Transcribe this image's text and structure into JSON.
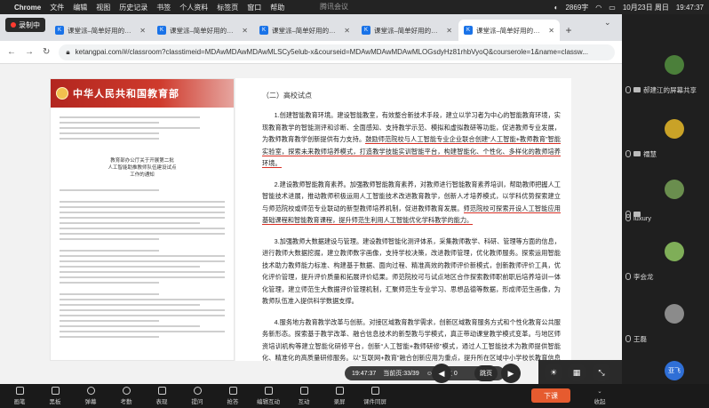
{
  "menubar": {
    "app": "Chrome",
    "items": [
      "文件",
      "编辑",
      "视图",
      "历史记录",
      "书签",
      "个人资料",
      "标签页",
      "窗口",
      "帮助"
    ],
    "center_title": "腾讯会议",
    "status": "2869字",
    "date": "10月23日 周日",
    "time": "19:47:37"
  },
  "recording": {
    "label": "录制中"
  },
  "tabs": [
    {
      "title": "课堂派–简单好用的互动课堂管理",
      "active": false
    },
    {
      "title": "课堂派–简单好用的互动课堂管理",
      "active": false
    },
    {
      "title": "课堂派–简单好用的互动课堂管理",
      "active": false
    },
    {
      "title": "课堂派–简单好用的互动课堂管理",
      "active": false
    },
    {
      "title": "课堂派–简单好用的互动课堂管理",
      "active": true
    }
  ],
  "tab_favicon": "K",
  "address": {
    "url": "ketangpai.com/#/classroom?classtimeid=MDAwMDAwMDAwMLSCy5elub-x&courseid=MDAwMDAwMDAwMLOGsdyHz81rhbVyoQ&courserole=1&name=classw..."
  },
  "doc_left": {
    "ministry": "中华人民共和国教育部",
    "title_lines": [
      "教育部办公厅关于开展第二批",
      "人工智能助推教师队伍建设试点",
      "工作的通知"
    ]
  },
  "doc_right": {
    "section_title": "（二）高校试点",
    "p1_a": "1.创建智能教育环境。建设智能教室，有效整合新技术手段，建立以学习者为中心的智能教育环境，实现教育教学的智能测评和诊断、全面感知、支持教学示范、模拟和虚拟教研等功能，促进教师专业发展，为教师教育教学创新提供有力支持。",
    "p1_b": "鼓励师范院校与人工智能专业企业联合创建“人工智能+教师教育”智能实验室，探索未来教师培养模式，打造教学技能实训智能平台，构建智能化、个性化、多样化的教师培养环境。",
    "p2_a": "2.建设教师智能教育素养。加强教师智能教育素养，对教师进行智能教育素养培训，帮助教师把握人工智能技术进展，推动教师积极运用人工智能技术改进教育教学，创新人才培养模式，以学科优势探索建立与师范院校或师范专业联动的新型教师培养机制，促进教师教育发展。",
    "p2_b": "师范院校可探索开设人工智能应用基础课程和智能教育课程，提升师范生利用人工智能优化学科教学的能力。",
    "p3": "3.加强教师大数据建设与管理。建设教师智能化测评体系，采集教师教学、科研、管理等方面的信息，进行教师大数据挖掘，建立教师数字画像，支持学校决策，改进教师管理，优化教师服务。探索运用智能技术助力教师能力标准、构建基于数据、面向过程、精准高效的教师评价新模式，创新教师评价工具，优化评价管理，提升评价质量和拓展评价结果。师范院校可与试点地区合作探索教师职前职后培养培训一体化管理，建立师范生大数据评价管理机制，汇聚师范生专业学习、思想品德等数据，形成师范生画像，为教师队伍准入提供科学数据支撑。",
    "p4": "4.服务地方教育教学改革与创新。对接区域教育教学需求，创新区域教育服务方式和个性化教育公共服务新形态。探索基于教学改革、融合信息技术的新型教与学模式，真正带动课堂教学模式变革。与地区师资培训机构等建立智能化研修平台，创新“人工智能+教师研修”模式，通过人工智能技术为教师提供智能化、精准化的高质量研修服务。以“互联网+教育”融合创新应用为重点，提升所在区域中小学校长教育信息化领导力和教师信息素养。"
  },
  "player": {
    "time": "19:47:37",
    "page": "当前页:33/39",
    "people": "人数 0",
    "jump": "跳页"
  },
  "participants": [
    {
      "name": "郝建江的屏幕共享",
      "color": "#4b7f3a"
    },
    {
      "name": "禤慧",
      "color": "#c9a227"
    },
    {
      "name": "",
      "color": "#6a8e4e"
    },
    {
      "name": "luxury",
      "color": "#3b6e9c"
    },
    {
      "name": "李会龙",
      "color": "#7fae58"
    },
    {
      "name": "王磊",
      "color": "#8b8b8b"
    },
    {
      "name": "亚飞",
      "color": "#2f6fd6"
    }
  ],
  "toolbar": {
    "items": [
      "画笔",
      "黑板",
      "弹幕",
      "考勤",
      "表现",
      "提问",
      "抢答",
      "编辑互动",
      "互动",
      "录屏",
      "课件同屏"
    ],
    "leave": "下课",
    "collapse": "收起"
  }
}
